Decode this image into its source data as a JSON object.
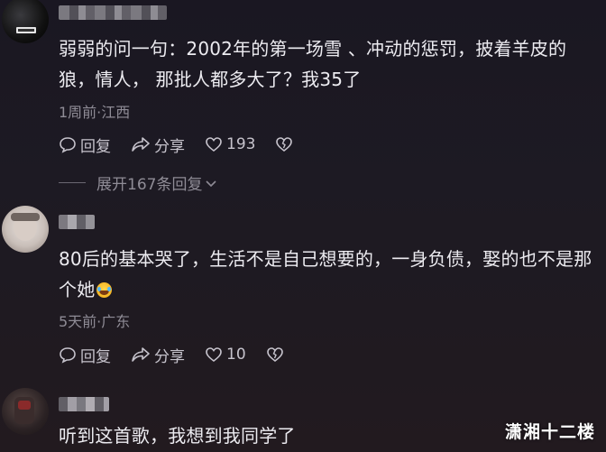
{
  "comments": [
    {
      "text": "弱弱的问一句：2002年的第一场雪 、冲动的惩罚，披着羊皮的狼，情人，  那批人都多大了？我35了",
      "meta": "1周前·江西",
      "reply_label": "回复",
      "share_label": "分享",
      "like_count": "193",
      "expand_label": "展开167条回复"
    },
    {
      "text": "80后的基本哭了，生活不是自己想要的，一身负债，娶的也不是那个她",
      "meta": "5天前·广东",
      "reply_label": "回复",
      "share_label": "分享",
      "like_count": "10"
    },
    {
      "text": "听到这首歌，我想到我同学了"
    }
  ],
  "watermark": "潇湘十二楼",
  "colors": {
    "background": "#1c1922",
    "text": "#ecebf0",
    "meta": "#8f8c96"
  }
}
